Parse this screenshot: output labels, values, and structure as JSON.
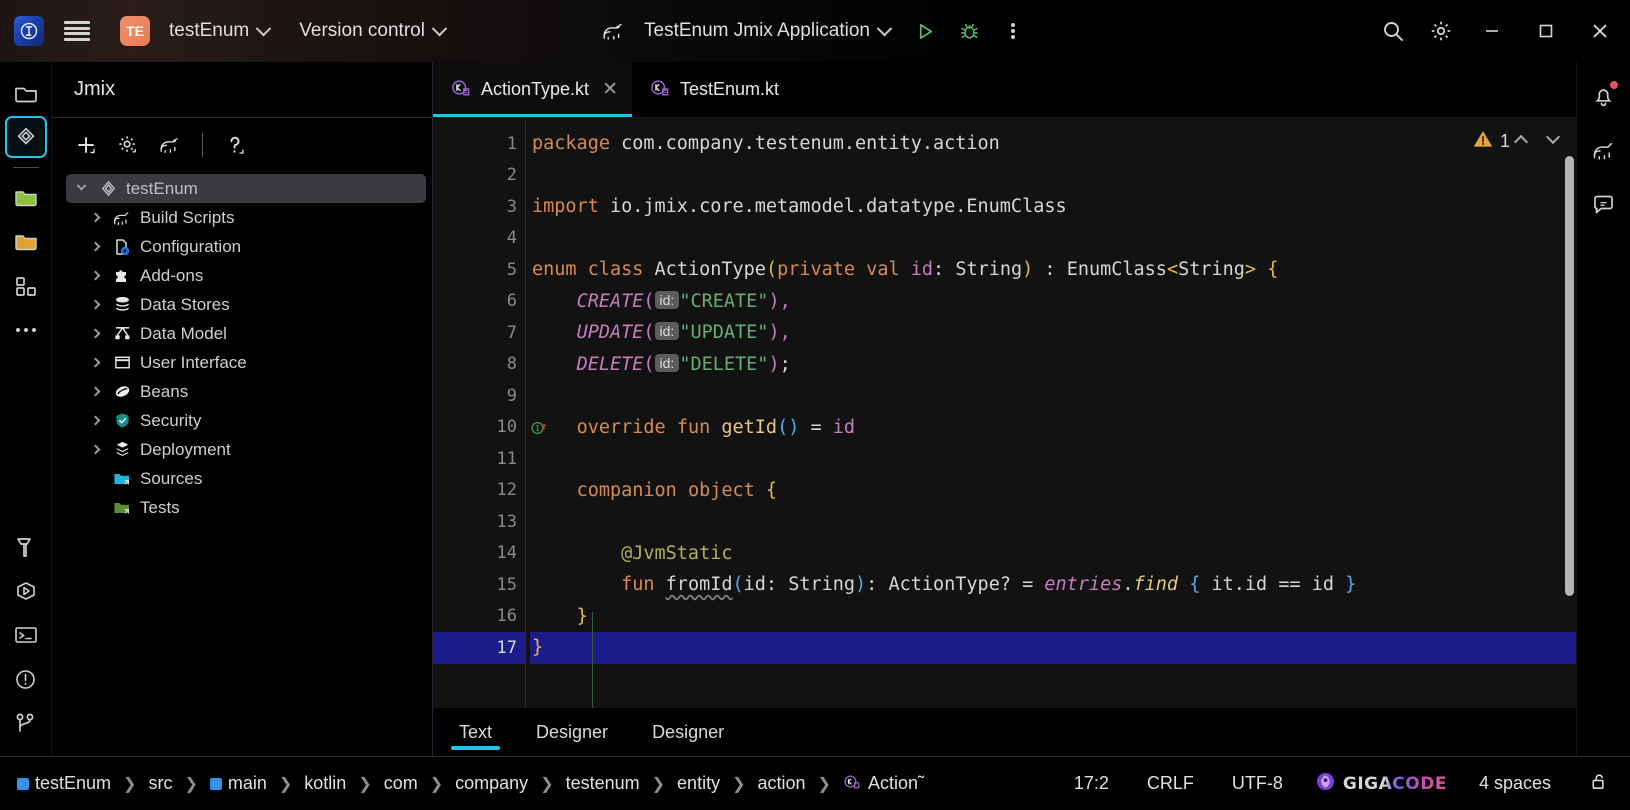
{
  "titlebar": {
    "menu_icon": "hamburger-menu-icon",
    "project_initials": "TE",
    "project_name": "testEnum",
    "version_control": "Version control",
    "run_config": "TestEnum Jmix Application",
    "run_icon": "gradle-elephant-icon",
    "play_label": "run-button",
    "debug_label": "debug-button",
    "more_label": "more-actions-button",
    "search_label": "search-everywhere",
    "settings_label": "settings",
    "minimize": "–",
    "maximize": "▢",
    "close": "✕"
  },
  "rail": {
    "items": [
      {
        "name": "project-files-icon",
        "label": "Project"
      },
      {
        "name": "jmix-icon",
        "label": "Jmix",
        "active": true
      },
      {
        "name": "commit-green-folder-icon",
        "label": "Commit"
      },
      {
        "name": "pull-requests-orange-folder-icon",
        "label": "Pull Requests"
      },
      {
        "name": "structure-icon",
        "label": "Structure"
      },
      {
        "name": "more-tool-windows-icon",
        "label": "More"
      },
      {
        "name": "build-hammer-icon",
        "label": "Build"
      },
      {
        "name": "run-icon",
        "label": "Run"
      },
      {
        "name": "terminal-icon",
        "label": "Terminal"
      },
      {
        "name": "problems-icon",
        "label": "Problems"
      },
      {
        "name": "version-control-branch-icon",
        "label": "Version Control"
      }
    ]
  },
  "project_panel": {
    "title": "Jmix",
    "toolbar": [
      {
        "name": "add-icon",
        "label": "New"
      },
      {
        "name": "gear-icon",
        "label": "Settings"
      },
      {
        "name": "gradle-elephant-icon",
        "label": "Gradle"
      },
      {
        "name": "help-icon",
        "label": "Help"
      }
    ],
    "tree": [
      {
        "label": "testEnum",
        "icon": "jmix-project-icon",
        "depth": 0,
        "arrow": "open",
        "selected": true
      },
      {
        "label": "Build Scripts",
        "icon": "gradle-elephant-icon",
        "depth": 1,
        "arrow": "collapsed"
      },
      {
        "label": "Configuration",
        "icon": "configuration-icon",
        "depth": 1,
        "arrow": "collapsed"
      },
      {
        "label": "Add-ons",
        "icon": "puzzle-icon",
        "depth": 1,
        "arrow": "collapsed"
      },
      {
        "label": "Data Stores",
        "icon": "database-icon",
        "depth": 1,
        "arrow": "collapsed"
      },
      {
        "label": "Data Model",
        "icon": "data-model-icon",
        "depth": 1,
        "arrow": "collapsed"
      },
      {
        "label": "User Interface",
        "icon": "window-icon",
        "depth": 1,
        "arrow": "collapsed"
      },
      {
        "label": "Beans",
        "icon": "bean-icon",
        "depth": 1,
        "arrow": "collapsed"
      },
      {
        "label": "Security",
        "icon": "shield-icon",
        "depth": 1,
        "arrow": "collapsed"
      },
      {
        "label": "Deployment",
        "icon": "deployment-icon",
        "depth": 1,
        "arrow": "collapsed"
      },
      {
        "label": "Sources",
        "icon": "blue-folder-icon",
        "depth": 1,
        "arrow": "none"
      },
      {
        "label": "Tests",
        "icon": "green-folder-icon",
        "depth": 1,
        "arrow": "none"
      }
    ]
  },
  "editor": {
    "tabs": [
      {
        "label": "ActionType.kt",
        "icon": "kotlin-file-icon",
        "active": true,
        "closable": true
      },
      {
        "label": "TestEnum.kt",
        "icon": "kotlin-file-icon",
        "active": false,
        "closable": false
      }
    ],
    "warning_count": "1",
    "warning_icon": "warning-triangle-icon",
    "line_numbers": [
      "1",
      "2",
      "3",
      "4",
      "5",
      "6",
      "7",
      "8",
      "9",
      "10",
      "11",
      "12",
      "13",
      "14",
      "15",
      "16",
      "17"
    ],
    "current_line": 17,
    "gutter_marker_line": 10,
    "gutter_marker_icon": "implementing-method-icon",
    "bottom_tabs": [
      {
        "label": "Text",
        "active": true
      },
      {
        "label": "Designer",
        "active": false
      },
      {
        "label": "Designer",
        "active": false
      }
    ]
  },
  "code": {
    "line1_kw": "package",
    "line1_rest": " com.company.testenum.entity.action",
    "line3_kw": "import",
    "line3_rest": " io.jmix.core.metamodel.datatype.EnumClass",
    "line5_enum": "enum",
    "line5_class": "class",
    "line5_name": "ActionType",
    "line5_private": "private",
    "line5_val": "val",
    "line5_id": "id",
    "line5_string": "String",
    "line5_enumclass": "EnumClass",
    "line5_generic": "String",
    "const_create": "CREATE",
    "const_update": "UPDATE",
    "const_delete": "DELETE",
    "hint_id": "id:",
    "str_create": "\"CREATE\"",
    "str_update": "\"UPDATE\"",
    "str_delete": "\"DELETE\"",
    "line10_override": "override",
    "line10_fun": "fun",
    "line10_getid": "getId",
    "line10_id": "id",
    "line12_companion": "companion",
    "line12_object": "object",
    "line14_annotation": "@JvmStatic",
    "line15_fun": "fun",
    "line15_name": "fromId",
    "line15_param": "id",
    "line15_ptype": "String",
    "line15_ret": "ActionType?",
    "line15_entries": "entries",
    "line15_find": "find",
    "line15_body": "it.id == id"
  },
  "right_rail": {
    "items": [
      {
        "name": "notifications-bell-icon",
        "label": "Notifications",
        "badge": true
      },
      {
        "name": "gradle-elephant-icon",
        "label": "Gradle"
      },
      {
        "name": "ai-assistant-icon",
        "label": "AI Assistant"
      }
    ]
  },
  "statusbar": {
    "breadcrumbs": [
      {
        "label": "testEnum",
        "icon": "module-icon"
      },
      {
        "label": "src",
        "icon": "none"
      },
      {
        "label": "main",
        "icon": "module-icon"
      },
      {
        "label": "kotlin",
        "icon": "none"
      },
      {
        "label": "com",
        "icon": "none"
      },
      {
        "label": "company",
        "icon": "none"
      },
      {
        "label": "testenum",
        "icon": "none"
      },
      {
        "label": "entity",
        "icon": "none"
      },
      {
        "label": "action",
        "icon": "none"
      },
      {
        "label": "Action˜",
        "icon": "kotlin-file-icon"
      }
    ],
    "caret": "17:2",
    "line_separator": "CRLF",
    "encoding": "UTF-8",
    "plugin_name": "GIGACODE",
    "indent": "4 spaces",
    "lock_icon": "unlocked-icon"
  },
  "colors": {
    "accent": "#25c3e8",
    "current_line": "#1c1c8a",
    "keyword": "#cf8e6d",
    "string": "#6aab73",
    "enum_const": "#c77dbb",
    "function": "#e8c77e",
    "annotation": "#b3ae60",
    "badge": "#e0565b"
  }
}
